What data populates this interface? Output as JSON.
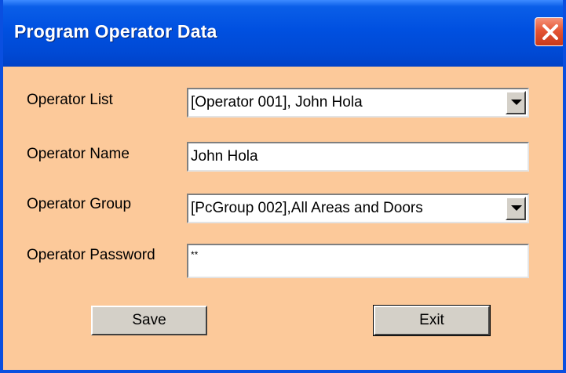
{
  "window": {
    "title": "Program Operator Data",
    "colors": {
      "titlebar": "#0050e0",
      "frame": "#0a4fe0",
      "background": "#fcc99a",
      "close": "#e45534"
    }
  },
  "form": {
    "operator_list": {
      "label": "Operator List",
      "value": "[Operator 001], John Hola"
    },
    "operator_name": {
      "label": "Operator Name",
      "value": "John Hola"
    },
    "operator_group": {
      "label": "Operator Group",
      "value": "[PcGroup 002],All Areas and Doors"
    },
    "operator_password": {
      "label": "Operator Password",
      "value": "**"
    }
  },
  "buttons": {
    "save": "Save",
    "exit": "Exit"
  },
  "icons": {
    "close": "close-icon",
    "dropdown": "chevron-down-icon"
  }
}
